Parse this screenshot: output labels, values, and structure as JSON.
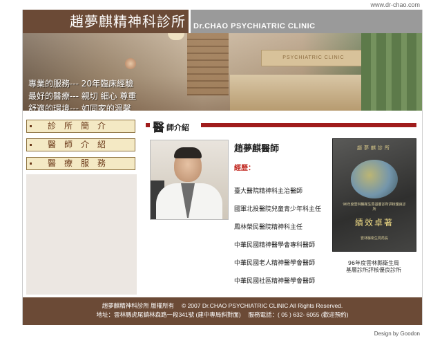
{
  "site_url": "www.dr-chao.com",
  "header": {
    "title_cn": "趙夢麒精神科診所",
    "title_en": "Dr.CHAO PSYCHIATRIC CLINIC"
  },
  "banner": {
    "sign_text": "PSYCHIATRIC CLINIC",
    "slogans": [
      "專業的服務--- 20年臨床經驗",
      "最好的醫療--- 親切 細心 尊重",
      "舒適的環境--- 如同家的溫馨"
    ]
  },
  "nav": {
    "items": [
      {
        "label": "診所簡介"
      },
      {
        "label": "醫師介紹"
      },
      {
        "label": "醫療服務"
      }
    ]
  },
  "section": {
    "title_big": "醫",
    "title_rest": "師介紹"
  },
  "doctor": {
    "name": "趙夢麒醫師",
    "experience_label": "經歷：",
    "experience": [
      "臺大醫院精神科主治醫師",
      "國軍北投醫院兒童青少年科主任",
      "鳳林榮民醫院精神科主任",
      "中華民國精神醫學會專科醫師",
      "中華民國老人精神醫學會醫師",
      "中華民國社區精神醫學會醫師"
    ]
  },
  "award": {
    "top_text": "趙夢麒診所",
    "small_text": "96年度雲林縣衛生局基層診所評核優良診所",
    "main_text": "績效卓著",
    "foot_text": "雲林縣衛生局局長",
    "caption_line1": "96年度雲林縣衛生局",
    "caption_line2": "基層診所評核優良診所"
  },
  "footer": {
    "line1": "趙夢麒精神科診所 版權所有　 © 2007  Dr.CHAO PSYCHIATRIC CLINIC  All Rights Reserved.",
    "line2": "地址：雲林縣虎尾鎮林森路一段341號 (建中專局斜對面)　 服務電話：( 05 ) 632- 6055 (歡迎預約)"
  },
  "credit": "Design by Goodon",
  "colors": {
    "brand_brown": "#6b4a36",
    "accent_red": "#a01c1c",
    "nav_bg": "#f4e9c4"
  }
}
